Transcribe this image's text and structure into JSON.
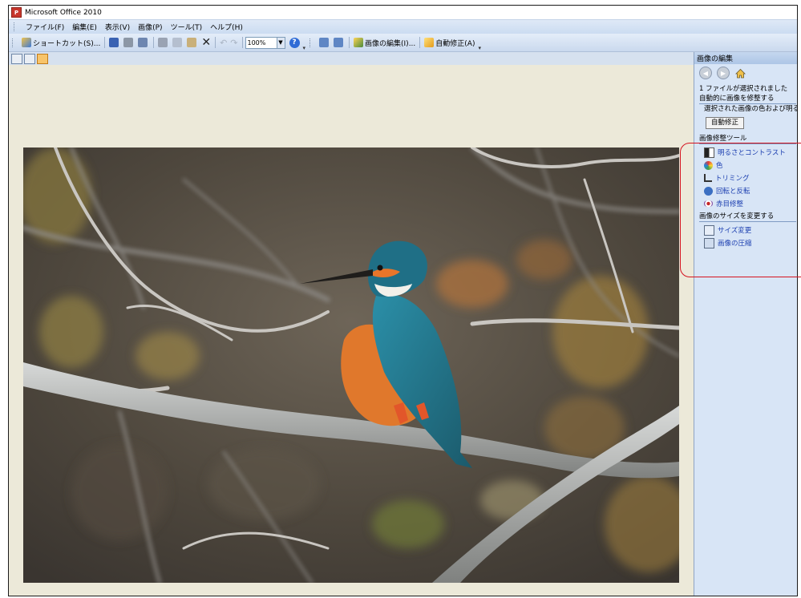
{
  "window": {
    "title": "Microsoft Office 2010"
  },
  "menu": [
    "ファイル(F)",
    "編集(E)",
    "表示(V)",
    "画像(P)",
    "ツール(T)",
    "ヘルプ(H)"
  ],
  "toolbar": {
    "shortcut_label": "ショートカット(S)...",
    "zoom_value": "100%",
    "edit_picture_label": "画像の編集(I)...",
    "auto_correct_label": "自動修正(A)"
  },
  "task_pane": {
    "title": "画像の編集",
    "selection_status": "1 ファイルが選択されました",
    "auto_section_title": "自動的に画像を修整する",
    "auto_section_desc": "選択された画像の色および明る",
    "auto_button_label": "自動修正",
    "tools_section_title": "画像修整ツール",
    "tools": [
      {
        "label": "明るさとコントラスト",
        "icon": "brightness-contrast-icon"
      },
      {
        "label": "色",
        "icon": "color-wheel-icon"
      },
      {
        "label": "トリミング",
        "icon": "crop-icon"
      },
      {
        "label": "回転と反転",
        "icon": "rotate-flip-icon"
      },
      {
        "label": "赤目修整",
        "icon": "red-eye-icon"
      }
    ],
    "resize_section_title": "画像のサイズを変更する",
    "resize_tools": [
      {
        "label": "サイズ変更",
        "icon": "resize-icon"
      },
      {
        "label": "画像の圧縮",
        "icon": "compress-icon"
      }
    ]
  },
  "colors": {
    "accent": "#d5121e",
    "link": "#1c3fb0",
    "pane_bg": "#d8e5f6"
  }
}
